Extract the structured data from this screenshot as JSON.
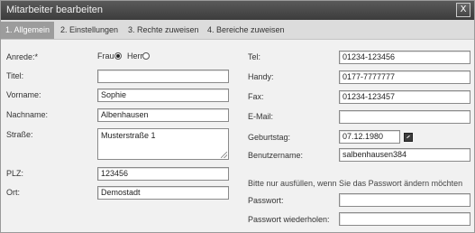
{
  "window": {
    "title": "Mitarbeiter bearbeiten",
    "close_label": "X"
  },
  "tabs": [
    {
      "label": "1. Allgemein",
      "active": true
    },
    {
      "label": "2. Einstellungen",
      "active": false
    },
    {
      "label": "3. Rechte zuweisen",
      "active": false
    },
    {
      "label": "4. Bereiche zuweisen",
      "active": false
    }
  ],
  "left": {
    "anrede": {
      "label": "Anrede:*",
      "option_frau": "Frau",
      "option_herr": "Herr",
      "selected": "Frau"
    },
    "titel": {
      "label": "Titel:",
      "value": ""
    },
    "vorname": {
      "label": "Vorname:",
      "value": "Sophie"
    },
    "nachname": {
      "label": "Nachname:",
      "value": "Albenhausen"
    },
    "strasse": {
      "label": "Straße:",
      "value": "Musterstraße 1"
    },
    "plz": {
      "label": "PLZ:",
      "value": "123456"
    },
    "ort": {
      "label": "Ort:",
      "value": "Demostadt"
    }
  },
  "right": {
    "tel": {
      "label": "Tel:",
      "value": "01234-123456"
    },
    "handy": {
      "label": "Handy:",
      "value": "0177-7777777"
    },
    "fax": {
      "label": "Fax:",
      "value": "01234-123457"
    },
    "email": {
      "label": "E-Mail:",
      "value": ""
    },
    "geburtstag": {
      "label": "Geburtstag:",
      "value": "07.12.1980"
    },
    "benutzername": {
      "label": "Benutzername:",
      "value": "salbenhausen384"
    },
    "password_note": "Bitte nur ausfüllen, wenn Sie das Passwort ändern möchten",
    "passwort": {
      "label": "Passwort:",
      "value": ""
    },
    "passwort_wdh": {
      "label": "Passwort wiederholen:",
      "value": ""
    }
  },
  "colors": {
    "titlebar": "#4a4a4a",
    "active_tab": "#9c9c9c",
    "background": "#f1f1f1"
  }
}
